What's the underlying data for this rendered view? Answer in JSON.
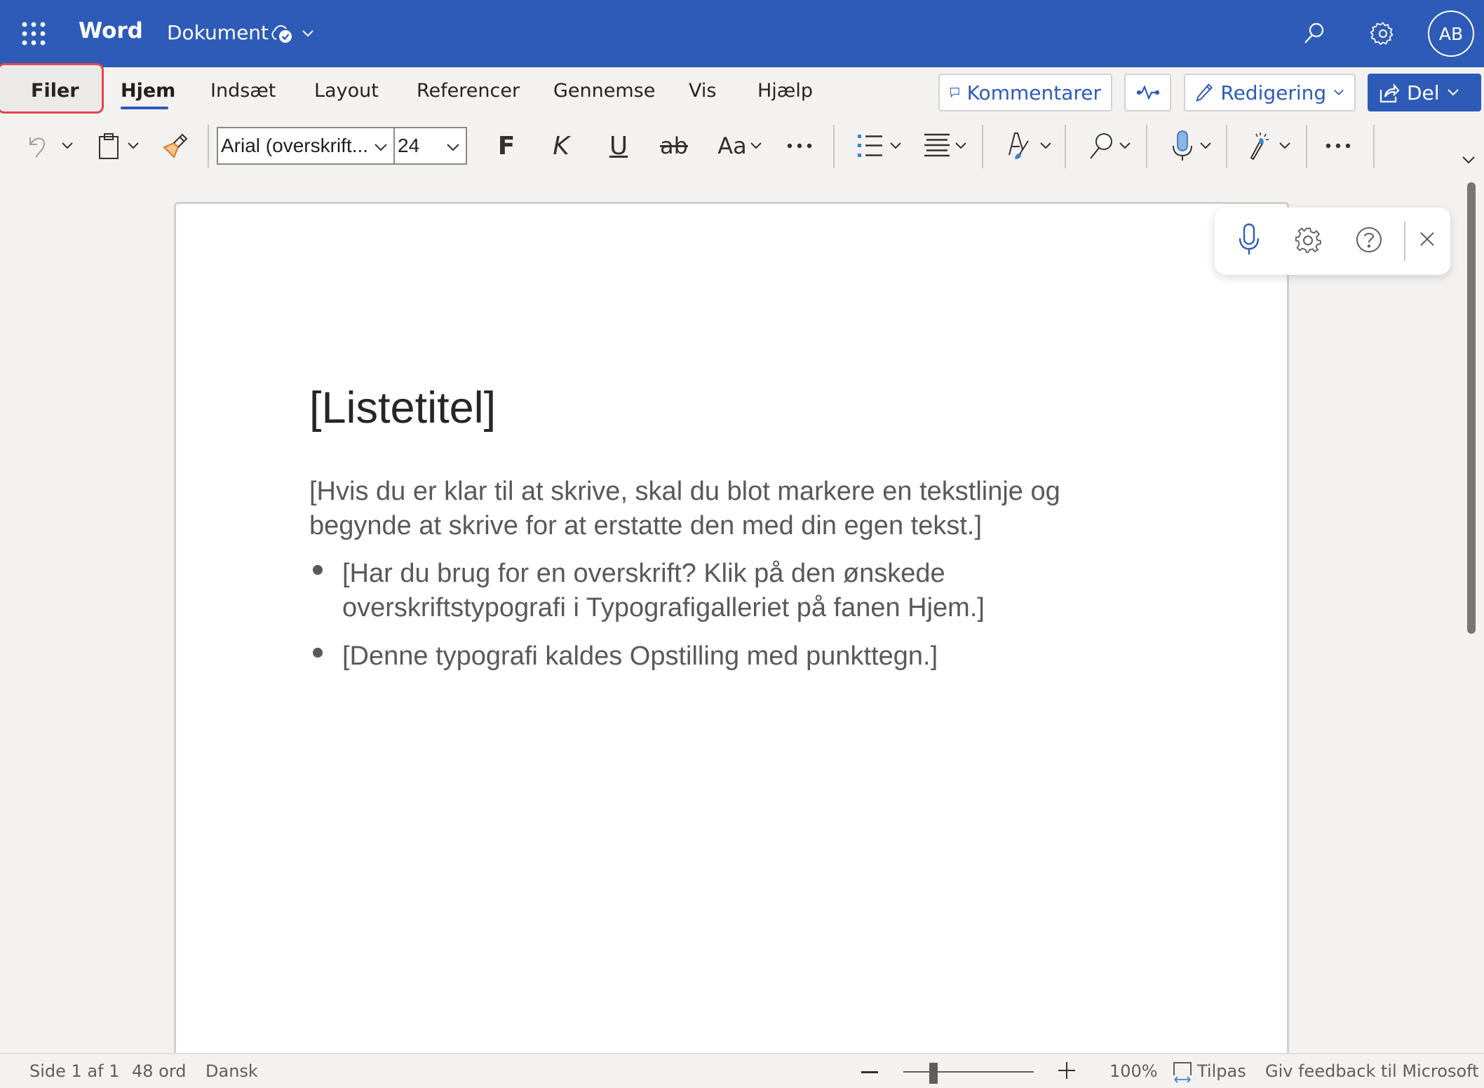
{
  "titlebar": {
    "app_name": "Word",
    "document_name": "Dokument",
    "save_status_icon": "cloud-saved-icon",
    "avatar_initials": "AB",
    "accent_color": "#2e5bb8"
  },
  "tabs": [
    {
      "label": "Filer",
      "highlighted": true
    },
    {
      "label": "Hjem",
      "active": true
    },
    {
      "label": "Indsæt"
    },
    {
      "label": "Layout"
    },
    {
      "label": "Referencer"
    },
    {
      "label": "Gennemse"
    },
    {
      "label": "Vis"
    },
    {
      "label": "Hjælp"
    }
  ],
  "actions": {
    "comments_label": "Kommentarer",
    "editing_label": "Redigering",
    "share_label": "Del"
  },
  "ribbon": {
    "font_name": "Arial (overskrift...",
    "font_size": "24",
    "bold_label": "F",
    "italic_label": "K",
    "underline_label": "U",
    "strikethrough_label": "ab",
    "case_label": "Aa",
    "more_label": "···"
  },
  "document": {
    "title": "[Listetitel]",
    "intro_lines": [
      "[Hvis du er klar til at skrive, skal du blot markere en tekstlinje og",
      "begynde at skrive for at erstatte den med din egen tekst.]"
    ],
    "bullets": [
      {
        "lines": [
          "[Har du brug for en overskrift? Klik på den ønskede",
          "overskriftstypografi i Typografigalleriet på fanen Hjem.]"
        ]
      },
      {
        "lines": [
          "[Denne typografi kaldes Opstilling med punkttegn.]"
        ]
      }
    ]
  },
  "dictation_panel": {
    "icons": [
      "microphone-icon",
      "gear-icon",
      "help-icon",
      "close-icon"
    ]
  },
  "statusbar": {
    "page_info": "Side 1 af 1",
    "word_count": "48 ord",
    "language": "Dansk",
    "zoom_level": "100%",
    "zoom_percent": 100,
    "fit_label": "Tilpas",
    "feedback_label": "Giv feedback til Microsoft"
  }
}
